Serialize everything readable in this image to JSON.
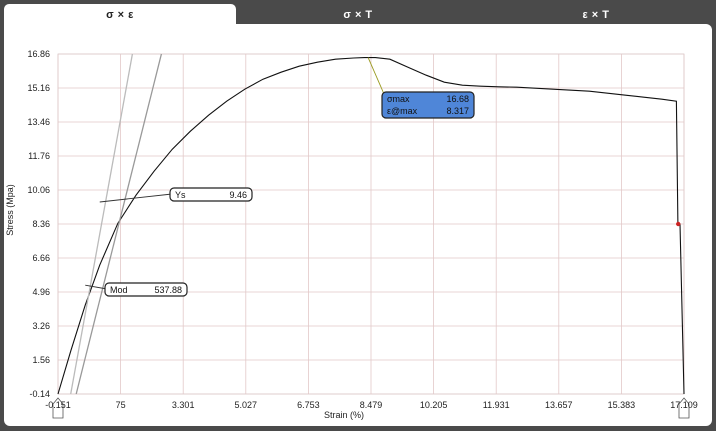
{
  "tabs": [
    {
      "label": "σ × ε",
      "active": true
    },
    {
      "label": "σ × T",
      "active": false
    },
    {
      "label": "ε × T",
      "active": false
    }
  ],
  "chart_data": {
    "type": "line",
    "xlabel": "Strain (%)",
    "ylabel": "Stress (Mpa)",
    "xlim": [
      -0.151,
      17.109
    ],
    "ylim": [
      -0.14,
      16.86
    ],
    "x_ticks": [
      {
        "value": -0.151,
        "label": "-0.151"
      },
      {
        "value": 1.575,
        "label": "75"
      },
      {
        "value": 3.301,
        "label": "3.301"
      },
      {
        "value": 5.027,
        "label": "5.027"
      },
      {
        "value": 6.753,
        "label": "6.753"
      },
      {
        "value": 8.479,
        "label": "8.479"
      },
      {
        "value": 10.205,
        "label": "10.205"
      },
      {
        "value": 11.931,
        "label": "11.931"
      },
      {
        "value": 13.657,
        "label": "13.657"
      },
      {
        "value": 15.383,
        "label": "15.383"
      },
      {
        "value": 17.109,
        "label": "17.109"
      }
    ],
    "y_ticks": [
      {
        "value": -0.14,
        "label": "-0.14"
      },
      {
        "value": 1.56,
        "label": "1.56"
      },
      {
        "value": 3.26,
        "label": "3.26"
      },
      {
        "value": 4.96,
        "label": "4.96"
      },
      {
        "value": 6.66,
        "label": "6.66"
      },
      {
        "value": 8.36,
        "label": "8.36"
      },
      {
        "value": 10.06,
        "label": "10.06"
      },
      {
        "value": 11.76,
        "label": "11.76"
      },
      {
        "value": 13.46,
        "label": "13.46"
      },
      {
        "value": 15.16,
        "label": "15.16"
      },
      {
        "value": 16.86,
        "label": "16.86"
      }
    ],
    "grid": true,
    "series": [
      {
        "color": "#111111",
        "x": [
          -0.151,
          0.2,
          0.6,
          1.0,
          1.5,
          2.0,
          2.5,
          3.0,
          3.5,
          4.0,
          4.5,
          5.0,
          5.5,
          6.0,
          6.5,
          7.0,
          7.5,
          8.0,
          8.3,
          8.6,
          9.0,
          9.5,
          10.0,
          10.5,
          11.0,
          11.5,
          12.0,
          12.5,
          13.0,
          13.5,
          14.0,
          14.5,
          15.0,
          15.5,
          16.0,
          16.5,
          16.9,
          16.94,
          17.0,
          17.109
        ],
        "y": [
          -0.14,
          2.0,
          4.3,
          6.3,
          8.4,
          9.8,
          11.0,
          12.1,
          13.0,
          13.8,
          14.5,
          15.1,
          15.6,
          15.95,
          16.25,
          16.45,
          16.6,
          16.66,
          16.68,
          16.68,
          16.6,
          16.2,
          15.8,
          15.45,
          15.3,
          15.25,
          15.22,
          15.2,
          15.15,
          15.1,
          15.05,
          15.0,
          14.9,
          14.8,
          14.7,
          14.6,
          14.5,
          8.36,
          8.36,
          -0.14
        ]
      },
      {
        "color": "#999999",
        "x": [
          0.35,
          2.7
        ],
        "y": [
          -0.14,
          16.86
        ]
      },
      {
        "color": "#bbbbbb",
        "x": [
          0.2,
          1.9
        ],
        "y": [
          -0.14,
          16.86
        ]
      }
    ],
    "markers": [
      {
        "x": 16.95,
        "y": 8.36,
        "color": "#cc2222"
      }
    ],
    "annotations": [
      {
        "name": "ys",
        "label": "Ys",
        "value": "9.46",
        "style": "white",
        "anchor_x": 1.0,
        "anchor_y": 9.46
      },
      {
        "name": "mod",
        "label": "Mod",
        "value": "537.88",
        "style": "white",
        "anchor_x": 0.6,
        "anchor_y": 5.3
      },
      {
        "name": "max",
        "label": "σmax",
        "value": "16.68",
        "label2": "ε@max",
        "value2": "8.317",
        "style": "blue",
        "anchor_x": 8.4,
        "anchor_y": 16.68
      }
    ]
  },
  "colors": {
    "frame": "#4a4a4a",
    "panel": "#ffffff",
    "grid": "#e2c8c8",
    "annotation_blue": "#4f86d8"
  }
}
